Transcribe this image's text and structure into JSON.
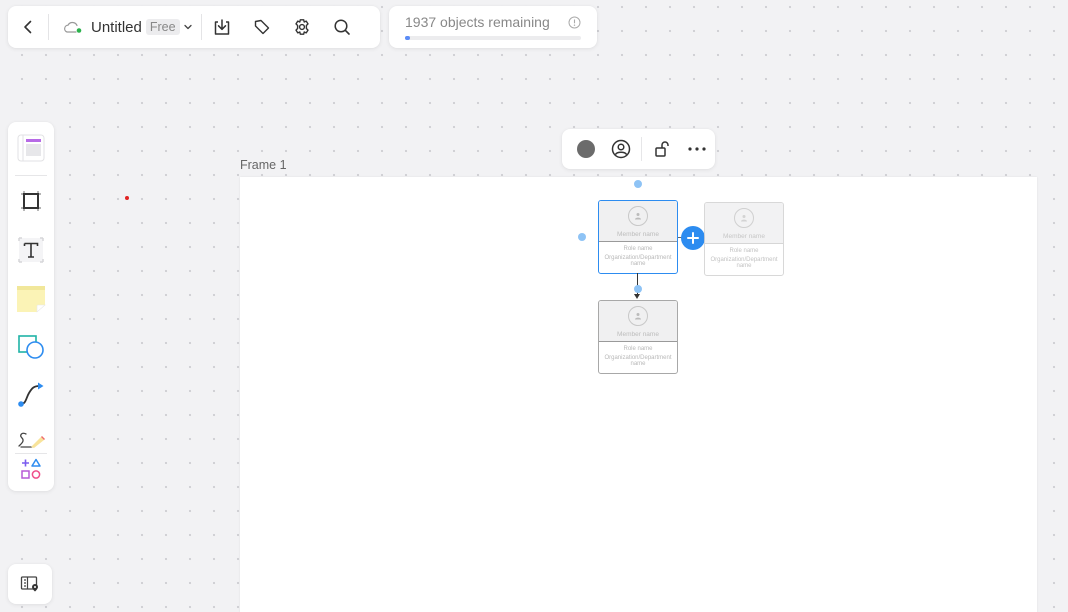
{
  "topbar": {
    "back_icon": "chevron-left-icon",
    "cloud_status_icon": "cloud-synced-icon",
    "doc_title": "Untitled",
    "plan_badge": "Free",
    "dropdown_icon": "chevron-down-icon",
    "actions": [
      {
        "name": "download",
        "icon": "download-icon"
      },
      {
        "name": "tag",
        "icon": "tag-icon"
      },
      {
        "name": "settings",
        "icon": "gear-icon"
      },
      {
        "name": "search",
        "icon": "search-icon"
      }
    ]
  },
  "quota": {
    "text": "1937 objects remaining",
    "info_icon": "info-icon",
    "progress_fraction": 0.03,
    "progress_color": "#5b8cf7"
  },
  "toolrail": {
    "tools": [
      {
        "name": "templates",
        "icon": "template-icon"
      },
      {
        "name": "frame",
        "icon": "frame-icon"
      },
      {
        "name": "text",
        "icon": "text-icon"
      },
      {
        "name": "sticky-note",
        "icon": "sticky-note-icon"
      },
      {
        "name": "shapes",
        "icon": "shapes-icon"
      },
      {
        "name": "connector",
        "icon": "connector-icon"
      },
      {
        "name": "pen",
        "icon": "pen-icon"
      },
      {
        "name": "more-tools",
        "icon": "more-tools-icon"
      }
    ]
  },
  "minimap": {
    "icon": "minimap-icon"
  },
  "canvas": {
    "frame_label": "Frame 1"
  },
  "context_toolbar": {
    "items": [
      {
        "name": "fill-color",
        "icon": "color-circle-icon",
        "color": "#6b6b6b"
      },
      {
        "name": "member-style",
        "icon": "user-circle-icon"
      },
      {
        "name": "lock",
        "icon": "unlock-icon"
      },
      {
        "name": "more",
        "icon": "more-horizontal-icon"
      }
    ]
  },
  "org_chart": {
    "accent": "#2d8cf0",
    "cards": [
      {
        "id": "root",
        "member_name": "Member name",
        "role": "Role name",
        "org": "Organization/Department name",
        "state": "selected"
      },
      {
        "id": "sibling-preview",
        "member_name": "Member name",
        "role": "Role name",
        "org": "Organization/Department name",
        "state": "preview"
      },
      {
        "id": "child",
        "member_name": "Member name",
        "role": "Role name",
        "org": "Organization/Department name",
        "state": "normal"
      }
    ]
  }
}
